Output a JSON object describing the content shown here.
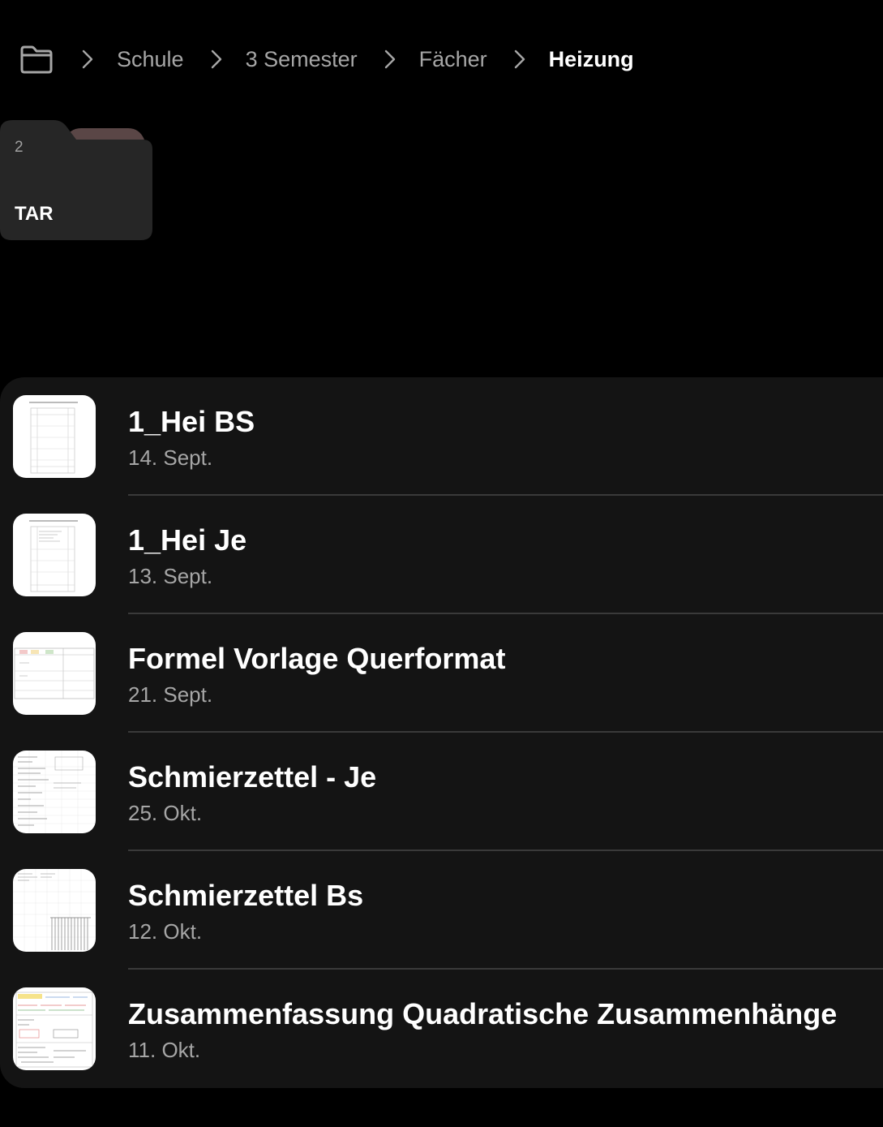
{
  "breadcrumb": {
    "root_icon": "folder-icon",
    "separator_icon": "chevron-right-icon",
    "items": [
      "Schule",
      "3 Semester",
      "Fächer"
    ],
    "current": "Heizung"
  },
  "folders": [
    {
      "name": "TAR",
      "count": "2",
      "icon": "folder-icon",
      "tab_color": "#5a4646"
    }
  ],
  "files": [
    {
      "title": "1_Hei BS",
      "date": "14. Sept.",
      "thumbnail": "note-page-thumbnail"
    },
    {
      "title": "1_Hei Je",
      "date": "13. Sept.",
      "thumbnail": "note-page-thumbnail"
    },
    {
      "title": "Formel Vorlage Querformat",
      "date": "21. Sept.",
      "thumbnail": "note-page-thumbnail"
    },
    {
      "title": "Schmierzettel - Je",
      "date": "25. Okt.",
      "thumbnail": "note-page-thumbnail"
    },
    {
      "title": "Schmierzettel Bs",
      "date": "12. Okt.",
      "thumbnail": "note-page-thumbnail"
    },
    {
      "title": "Zusammenfassung Quadratische Zusammenhänge",
      "date": "11. Okt.",
      "thumbnail": "note-page-thumbnail"
    }
  ],
  "colors": {
    "background": "#000000",
    "list_background": "#141414",
    "folder_body": "#262626",
    "divider": "#3a3a3a",
    "muted_text": "#a6a6a6"
  }
}
